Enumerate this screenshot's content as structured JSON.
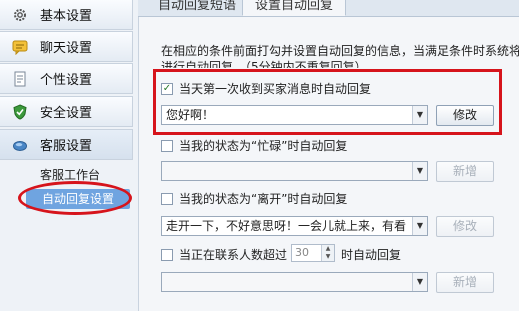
{
  "sidebar": {
    "items": [
      {
        "label": "基本设置",
        "icon": "gear-icon"
      },
      {
        "label": "聊天设置",
        "icon": "chat-icon"
      },
      {
        "label": "个性设置",
        "icon": "document-icon"
      },
      {
        "label": "安全设置",
        "icon": "shield-icon"
      },
      {
        "label": "客服设置",
        "icon": "headset-icon"
      }
    ],
    "sub_items": [
      {
        "label": "客服工作台"
      },
      {
        "label": "自动回复设置"
      }
    ]
  },
  "tabs": [
    {
      "label": "自动回复短语"
    },
    {
      "label": "设置自动回复"
    }
  ],
  "main": {
    "description_line1": "在相应的条件前面打勾并设置自动回复的信息，当满足条件时系统将",
    "description_line2": "进行自动回复。（5分钟内不重复回复）",
    "first_contact": {
      "label": "当天第一次收到买家消息时自动回复",
      "checked_mark": "✓",
      "value": "您好啊！",
      "button": "修改"
    },
    "busy": {
      "label": "当我的状态为“忙碌”时自动回复",
      "value": "",
      "button": "新增"
    },
    "away": {
      "label": "当我的状态为“离开”时自动回复",
      "value": "走开一下，不好意思呀！一会儿就上来，有看",
      "button": "修改"
    },
    "count": {
      "label_before": "当正在联系人数超过",
      "number": "30",
      "label_after": "时自动回复",
      "value": "",
      "button": "新增"
    }
  },
  "colors": {
    "annotation_red": "#d6141c",
    "selected_blue": "#6fa4e0"
  }
}
